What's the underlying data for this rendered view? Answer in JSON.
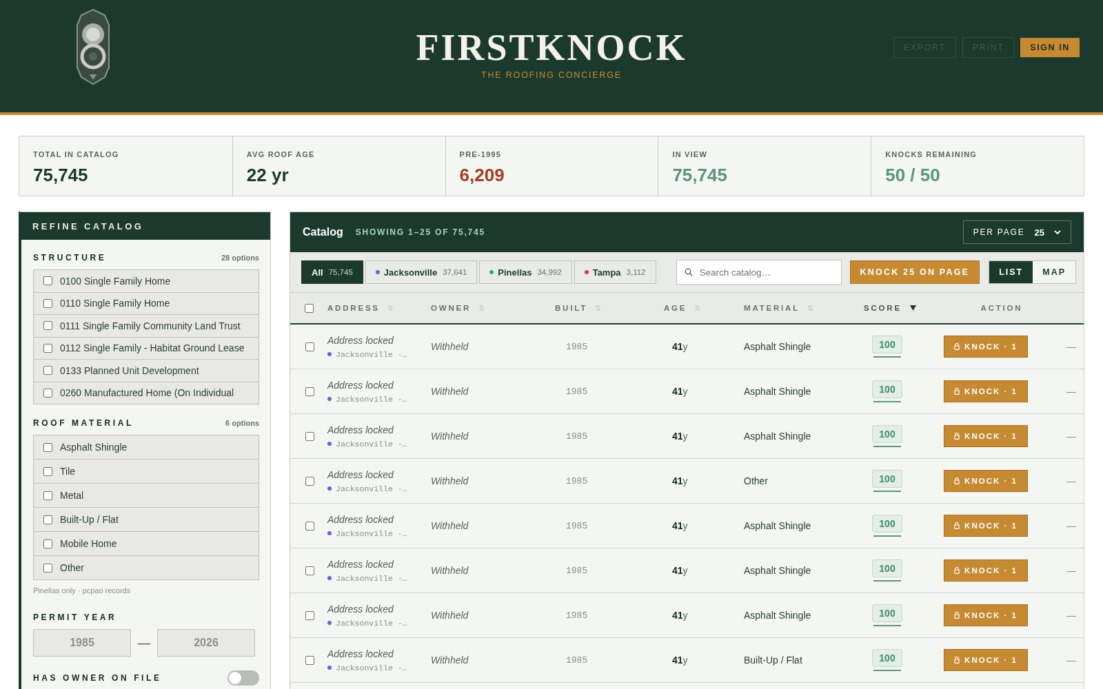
{
  "header": {
    "brand": "FIRSTKNOCK",
    "tagline": "THE ROOFING CONCIERGE",
    "buttons": [
      {
        "label": "EXPORT",
        "kind": "muted"
      },
      {
        "label": "PRINT",
        "kind": "muted"
      },
      {
        "label": "SIGN IN",
        "kind": "primary"
      }
    ]
  },
  "stats": [
    {
      "label": "TOTAL IN CATALOG",
      "value": "75,745",
      "color": "#1b3a2d"
    },
    {
      "label": "AVG ROOF AGE",
      "value": "22 yr",
      "color": "#1b3a2d"
    },
    {
      "label": "PRE-1995",
      "value": "6,209",
      "color": "#a33b24"
    },
    {
      "label": "IN VIEW",
      "value": "75,745",
      "color": "#5b957c"
    },
    {
      "label": "KNOCKS REMAINING",
      "value": "50 / 50",
      "color": "#5b957c"
    }
  ],
  "sidebar": {
    "title": "REFINE CATALOG",
    "structure": {
      "title": "STRUCTURE",
      "count": "28 options",
      "options": [
        {
          "label": "0100 Single Family Home",
          "checked": false
        },
        {
          "label": "0110 Single Family Home",
          "checked": false
        },
        {
          "label": "0111 Single Family Community Land Trust",
          "checked": false
        },
        {
          "label": "0112 Single Family - Habitat Ground Lease",
          "checked": false
        },
        {
          "label": "0133 Planned Unit Development",
          "checked": false
        },
        {
          "label": "0260 Manufactured Home (On Individual",
          "checked": false
        }
      ]
    },
    "roof_material": {
      "title": "ROOF MATERIAL",
      "count": "6 options",
      "options": [
        {
          "label": "Asphalt Shingle",
          "checked": false
        },
        {
          "label": "Tile",
          "checked": false
        },
        {
          "label": "Metal",
          "checked": false
        },
        {
          "label": "Built-Up / Flat",
          "checked": false
        },
        {
          "label": "Mobile Home",
          "checked": false
        },
        {
          "label": "Other",
          "checked": false
        }
      ],
      "note": "Pinellas only · pcpao records"
    },
    "permit_year": {
      "title": "PERMIT YEAR",
      "from": "1985",
      "separator": "—",
      "to": "2026"
    },
    "owner_toggle": {
      "label": "HAS OWNER ON FILE",
      "on": false
    }
  },
  "catalog": {
    "title": "Catalog",
    "showing": "SHOWING 1–25 OF 75,745",
    "per_page": {
      "label": "PER PAGE",
      "value": "25"
    },
    "regions": [
      {
        "label": "All",
        "count": "75,745",
        "selected": true
      },
      {
        "label": "Jacksonville",
        "count": "37,641",
        "selected": false,
        "color": "#6a5fe0"
      },
      {
        "label": "Pinellas",
        "count": "34,992",
        "selected": false,
        "color": "#1fa89a"
      },
      {
        "label": "Tampa",
        "count": "3,112",
        "selected": false,
        "color": "#e0335a"
      }
    ],
    "search": {
      "placeholder": "Search catalog…"
    },
    "bulk_button": "KNOCK 25 ON PAGE",
    "views": [
      {
        "label": "LIST",
        "selected": true
      },
      {
        "label": "MAP",
        "selected": false
      }
    ],
    "columns": [
      {
        "label": "ADDRESS",
        "sorted": false
      },
      {
        "label": "OWNER",
        "sorted": false
      },
      {
        "label": "BUILT",
        "sorted": false
      },
      {
        "label": "AGE",
        "sorted": false
      },
      {
        "label": "MATERIAL",
        "sorted": false
      },
      {
        "label": "SCORE",
        "sorted": true
      }
    ],
    "action_column": "ACTION",
    "all_checked": false,
    "rows": [
      {
        "address": "Address locked",
        "city": "Jacksonville ·…",
        "color": "#6a5fe0",
        "owner": "Withheld",
        "built": "1985",
        "age": "41",
        "unit": "y",
        "material": "Asphalt Shingle",
        "score": "100",
        "action": "KNOCK · 1",
        "trailing": "—",
        "checked": false
      },
      {
        "address": "Address locked",
        "city": "Jacksonville ·…",
        "color": "#6a5fe0",
        "owner": "Withheld",
        "built": "1985",
        "age": "41",
        "unit": "y",
        "material": "Asphalt Shingle",
        "score": "100",
        "action": "KNOCK · 1",
        "trailing": "—",
        "checked": false
      },
      {
        "address": "Address locked",
        "city": "Jacksonville ·…",
        "color": "#6a5fe0",
        "owner": "Withheld",
        "built": "1985",
        "age": "41",
        "unit": "y",
        "material": "Asphalt Shingle",
        "score": "100",
        "action": "KNOCK · 1",
        "trailing": "—",
        "checked": false
      },
      {
        "address": "Address locked",
        "city": "Jacksonville ·…",
        "color": "#6a5fe0",
        "owner": "Withheld",
        "built": "1985",
        "age": "41",
        "unit": "y",
        "material": "Other",
        "score": "100",
        "action": "KNOCK · 1",
        "trailing": "—",
        "checked": false
      },
      {
        "address": "Address locked",
        "city": "Jacksonville ·…",
        "color": "#6a5fe0",
        "owner": "Withheld",
        "built": "1985",
        "age": "41",
        "unit": "y",
        "material": "Asphalt Shingle",
        "score": "100",
        "action": "KNOCK · 1",
        "trailing": "—",
        "checked": false
      },
      {
        "address": "Address locked",
        "city": "Jacksonville ·…",
        "color": "#6a5fe0",
        "owner": "Withheld",
        "built": "1985",
        "age": "41",
        "unit": "y",
        "material": "Asphalt Shingle",
        "score": "100",
        "action": "KNOCK · 1",
        "trailing": "—",
        "checked": false
      },
      {
        "address": "Address locked",
        "city": "Jacksonville ·…",
        "color": "#6a5fe0",
        "owner": "Withheld",
        "built": "1985",
        "age": "41",
        "unit": "y",
        "material": "Asphalt Shingle",
        "score": "100",
        "action": "KNOCK · 1",
        "trailing": "—",
        "checked": false
      },
      {
        "address": "Address locked",
        "city": "Jacksonville ·…",
        "color": "#6a5fe0",
        "owner": "Withheld",
        "built": "1985",
        "age": "41",
        "unit": "y",
        "material": "Built-Up / Flat",
        "score": "100",
        "action": "KNOCK · 1",
        "trailing": "—",
        "checked": false
      }
    ]
  }
}
